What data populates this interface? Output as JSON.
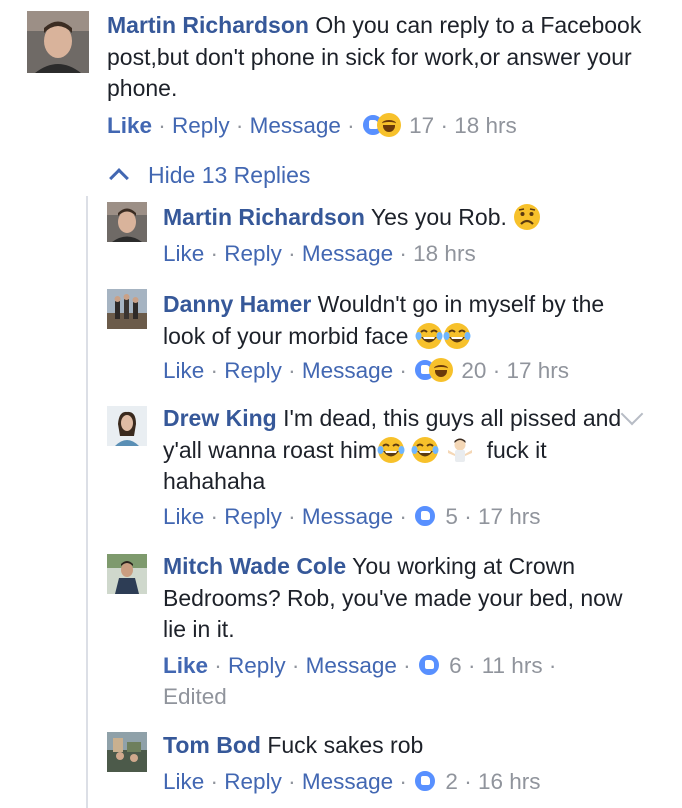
{
  "top_comment": {
    "author": "Martin Richardson",
    "text": "Oh you can reply to a Facebook post,but don't phone in sick for work,or answer your phone.",
    "actions": {
      "like": "Like",
      "reply": "Reply",
      "message": "Message"
    },
    "reaction_count": "17",
    "time": "18 hrs"
  },
  "hide_replies_label": "Hide 13 Replies",
  "replies": [
    {
      "author": "Martin Richardson",
      "text": "Yes you Rob.",
      "actions": {
        "like": "Like",
        "reply": "Reply",
        "message": "Message"
      },
      "time": "18 hrs"
    },
    {
      "author": "Danny Hamer",
      "text": "Wouldn't go in myself by the look of your morbid face",
      "actions": {
        "like": "Like",
        "reply": "Reply",
        "message": "Message"
      },
      "reaction_count": "20",
      "time": "17 hrs"
    },
    {
      "author": "Drew King",
      "text_a": "I'm dead, this guys all pissed and y'all wanna roast him",
      "text_b": "fuck it hahahaha",
      "actions": {
        "like": "Like",
        "reply": "Reply",
        "message": "Message"
      },
      "reaction_count": "5",
      "time": "17 hrs"
    },
    {
      "author": "Mitch Wade Cole",
      "text": "You working at Crown Bedrooms? Rob, you've made your bed, now lie in it.",
      "actions": {
        "like": "Like",
        "reply": "Reply",
        "message": "Message"
      },
      "reaction_count": "6",
      "time": "11 hrs",
      "edited": "Edited"
    },
    {
      "author": "Tom Bod",
      "text": "Fuck sakes rob",
      "actions": {
        "like": "Like",
        "reply": "Reply",
        "message": "Message"
      },
      "reaction_count": "2",
      "time": "16 hrs"
    }
  ]
}
